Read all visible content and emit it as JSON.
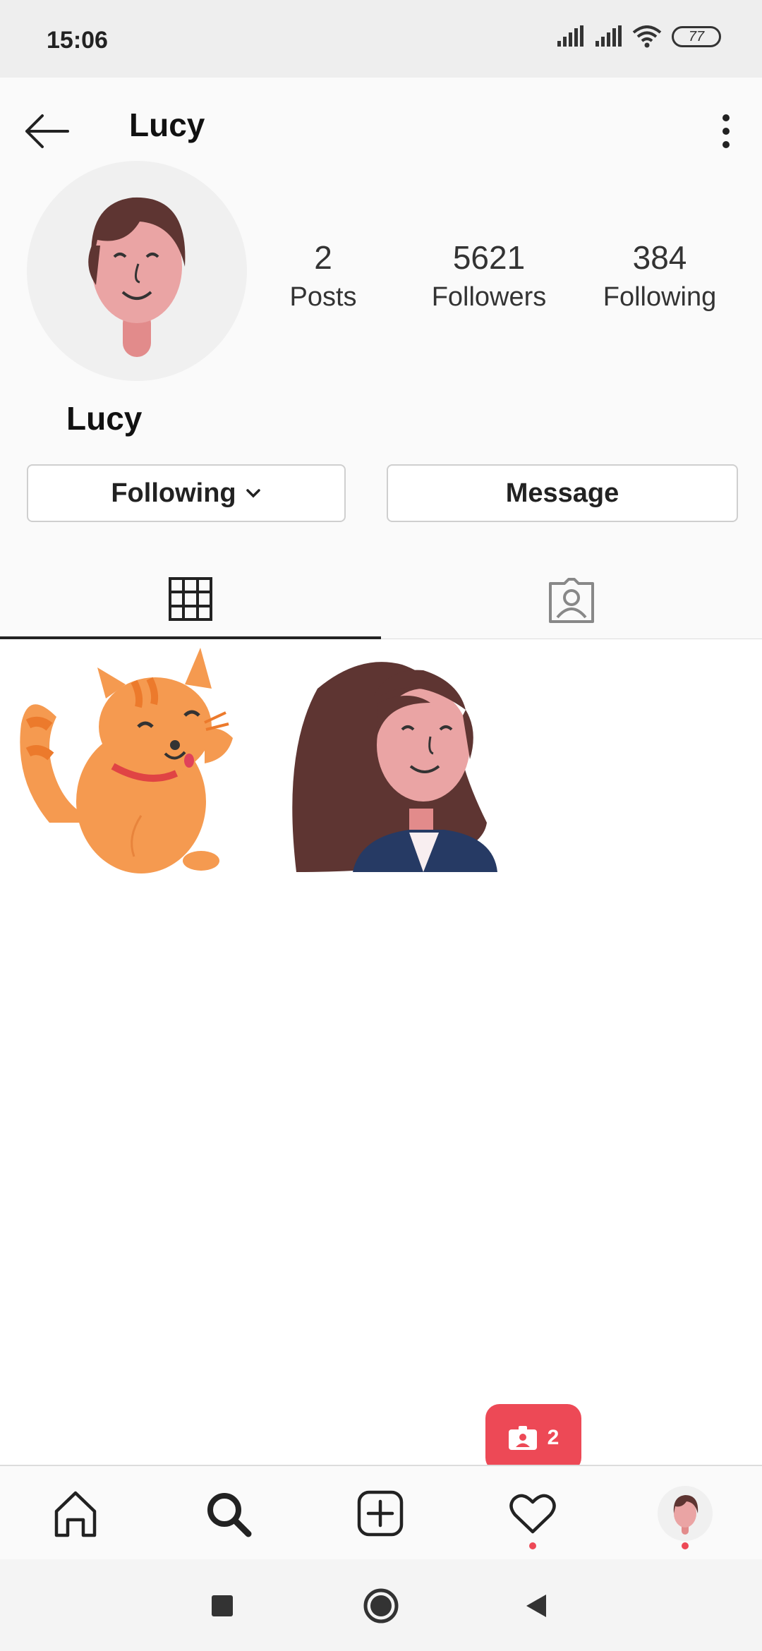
{
  "status_bar": {
    "time": "15:06",
    "battery": "77",
    "icons": [
      "signal-icon",
      "signal-icon",
      "wifi-icon",
      "battery-icon"
    ]
  },
  "header": {
    "title": "Lucy",
    "back_icon": "arrow-left-icon",
    "more_icon": "more-vertical-icon"
  },
  "profile": {
    "display_name": "Lucy",
    "stats": {
      "posts": {
        "value": "2",
        "label": "Posts"
      },
      "followers": {
        "value": "5621",
        "label": "Followers"
      },
      "following": {
        "value": "384",
        "label": "Following"
      }
    },
    "buttons": {
      "following": "Following",
      "message": "Message"
    }
  },
  "tabs": [
    {
      "name": "grid",
      "icon": "grid-icon",
      "active": true
    },
    {
      "name": "tagged",
      "icon": "tagged-person-icon",
      "active": false
    }
  ],
  "posts": [
    {
      "subject": "cat-illustration"
    },
    {
      "subject": "woman-illustration"
    }
  ],
  "notification": {
    "icon": "person-badge-icon",
    "count": "2"
  },
  "bottom_nav": [
    {
      "name": "home",
      "icon": "home-icon"
    },
    {
      "name": "search",
      "icon": "search-icon"
    },
    {
      "name": "add",
      "icon": "add-post-icon"
    },
    {
      "name": "activity",
      "icon": "heart-icon"
    },
    {
      "name": "profile",
      "icon": "avatar-icon"
    }
  ],
  "colors": {
    "accent_red": "#ed4956",
    "cat_orange": "#f59a50",
    "hair_brown": "#5e3532",
    "skin": "#eaa4a4"
  }
}
